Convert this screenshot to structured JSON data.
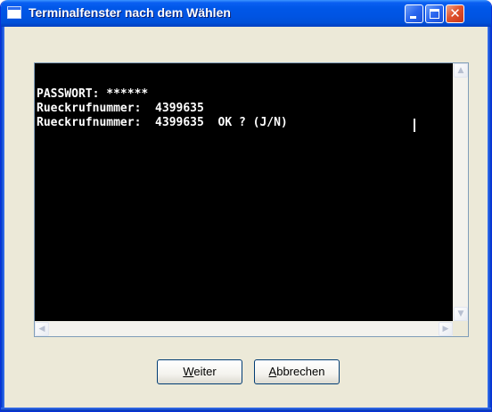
{
  "window": {
    "title": "Terminalfenster nach dem Wählen"
  },
  "terminal": {
    "lines": [
      "PASSWORT: ******",
      "Rueckrufnummer:  4399635",
      "Rueckrufnummer:  4399635  OK ? (J/N)"
    ]
  },
  "buttons": {
    "weiter": {
      "mnemonic": "W",
      "rest": "eiter"
    },
    "abbrechen": {
      "mnemonic": "A",
      "rest": "bbrechen"
    }
  },
  "colors": {
    "titlebar": "#0054e3",
    "terminal_bg": "#000000",
    "terminal_fg": "#ffffff",
    "close_button": "#e0542e"
  },
  "icons": {
    "window": "window-icon",
    "minimize": "minimize-icon",
    "maximize": "maximize-icon",
    "close": "close-icon"
  }
}
